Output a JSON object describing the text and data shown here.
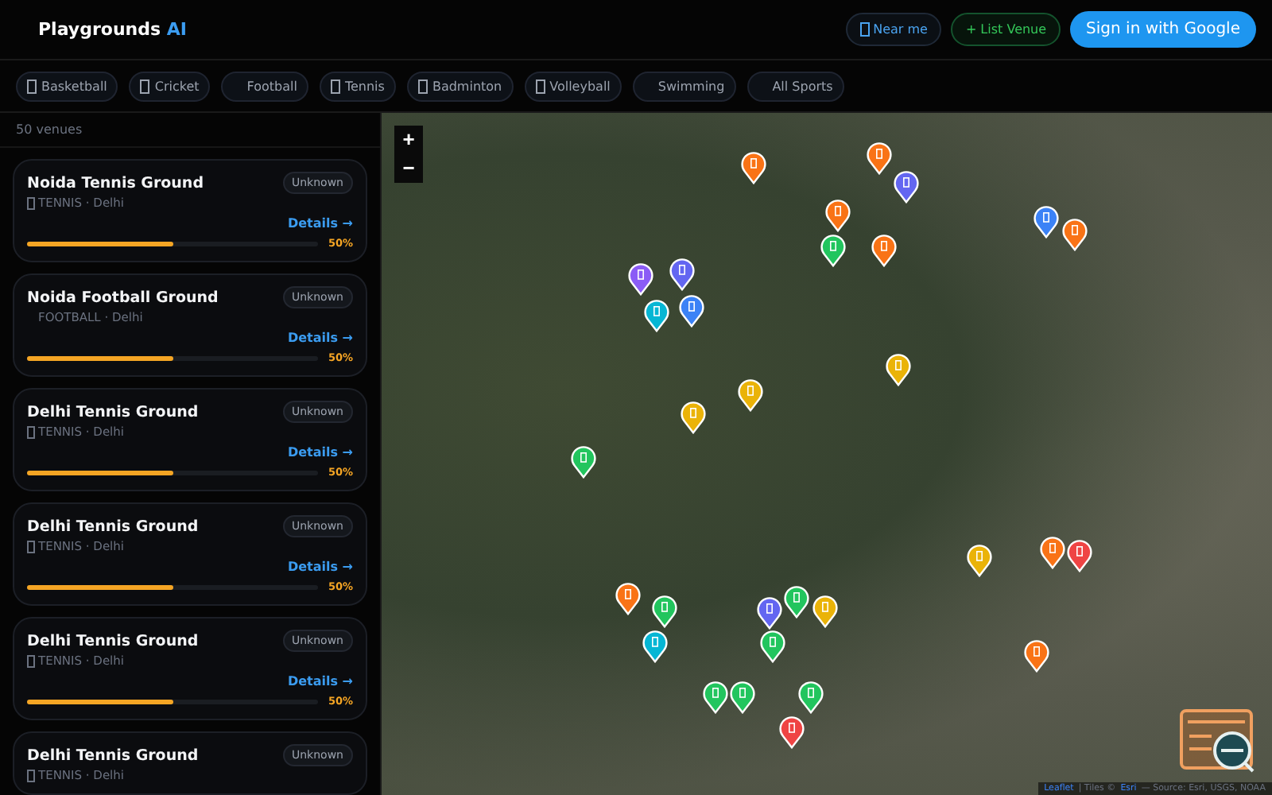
{
  "brand": {
    "name": "Playgrounds",
    "accent": "AI"
  },
  "header_buttons": [
    {
      "kind": "near",
      "label": "Near me"
    },
    {
      "kind": "list",
      "label": "+ List Venue"
    },
    {
      "kind": "signin",
      "label": "Sign in with Google"
    }
  ],
  "sport_filters": [
    {
      "label": "Basketball",
      "icon_shown": true
    },
    {
      "label": "Cricket",
      "icon_shown": true
    },
    {
      "label": "Football",
      "icon_shown": false
    },
    {
      "label": "Tennis",
      "icon_shown": true
    },
    {
      "label": "Badminton",
      "icon_shown": true
    },
    {
      "label": "Volleyball",
      "icon_shown": true
    },
    {
      "label": "Swimming",
      "icon_shown": false
    },
    {
      "label": "All Sports",
      "icon_shown": false
    }
  ],
  "venue_count": "50 venues",
  "venues": [
    {
      "name": "Noida Tennis Ground",
      "status": "Unknown",
      "sport": "TENNIS · Delhi",
      "icon_shown": true,
      "details": "Details →",
      "level": 0.5,
      "reading": "50%"
    },
    {
      "name": "Noida Football Ground",
      "status": "Unknown",
      "sport": "FOOTBALL · Delhi",
      "icon_shown": false,
      "details": "Details →",
      "level": 0.5,
      "reading": "50%"
    },
    {
      "name": "Delhi Tennis Ground",
      "status": "Unknown",
      "sport": "TENNIS · Delhi",
      "icon_shown": true,
      "details": "Details →",
      "level": 0.5,
      "reading": "50%"
    },
    {
      "name": "Delhi Tennis Ground",
      "status": "Unknown",
      "sport": "TENNIS · Delhi",
      "icon_shown": true,
      "details": "Details →",
      "level": 0.5,
      "reading": "50%"
    },
    {
      "name": "Delhi Tennis Ground",
      "status": "Unknown",
      "sport": "TENNIS · Delhi",
      "icon_shown": true,
      "details": "Details →",
      "level": 0.5,
      "reading": "50%"
    },
    {
      "name": "Delhi Tennis Ground",
      "status": "Unknown",
      "sport": "TENNIS · Delhi",
      "icon_shown": true
    }
  ],
  "map": {
    "zoom_in": "+",
    "zoom_out": "−",
    "markers": [
      {
        "color": "#f97316"
      },
      {
        "color": "#f97316"
      },
      {
        "color": "#6366f1"
      },
      {
        "color": "#f97316"
      },
      {
        "color": "#22c55e"
      },
      {
        "color": "#f97316"
      },
      {
        "color": "#3b82f6"
      },
      {
        "color": "#f97316"
      },
      {
        "color": "#8b5cf6"
      },
      {
        "color": "#6366f1"
      },
      {
        "color": "#3b82f6"
      },
      {
        "color": "#06b6d4"
      },
      {
        "color": "#eab308"
      },
      {
        "color": "#eab308"
      },
      {
        "color": "#eab308"
      },
      {
        "color": "#22c55e"
      },
      {
        "color": "#eab308"
      },
      {
        "color": "#f97316"
      },
      {
        "color": "#ef4444"
      },
      {
        "color": "#f97316"
      },
      {
        "color": "#22c55e"
      },
      {
        "color": "#06b6d4"
      },
      {
        "color": "#22c55e"
      },
      {
        "color": "#6366f1"
      },
      {
        "color": "#22c55e"
      },
      {
        "color": "#eab308"
      },
      {
        "color": "#f97316"
      },
      {
        "color": "#22c55e"
      },
      {
        "color": "#22c55e"
      },
      {
        "color": "#22c55e"
      },
      {
        "color": "#ef4444"
      }
    ],
    "attribution": [
      {
        "kind": "link",
        "text": "Leaflet"
      },
      {
        "kind": "plain",
        "text": "| Tiles ©"
      },
      {
        "kind": "link",
        "text": "Esri"
      },
      {
        "kind": "plain",
        "text": "— Source: Esri, USGS, NOAA"
      }
    ]
  }
}
